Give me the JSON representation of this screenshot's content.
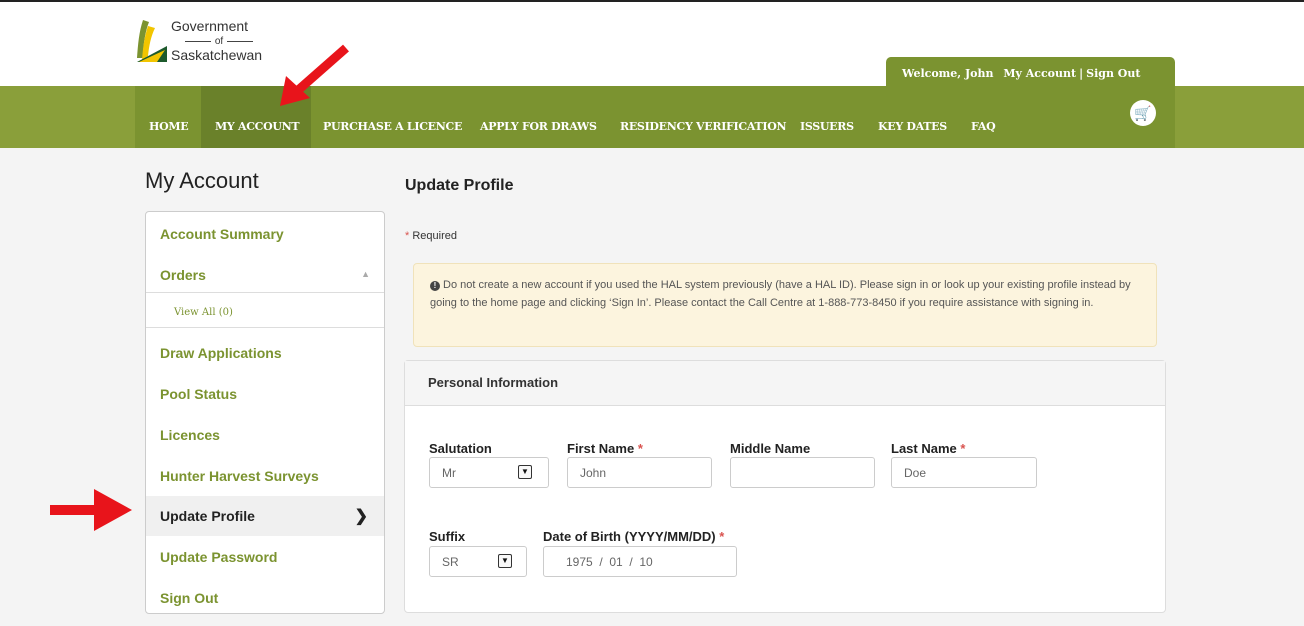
{
  "logo": {
    "line1": "Government",
    "line2": "of",
    "line3": "Saskatchewan"
  },
  "welcome": {
    "greeting": "Welcome, John",
    "account": "My Account",
    "sep": "|",
    "signout": "Sign Out"
  },
  "nav": {
    "items": [
      "HOME",
      "MY ACCOUNT",
      "PURCHASE A LICENCE",
      "APPLY FOR DRAWS",
      "RESIDENCY VERIFICATION",
      "ISSUERS",
      "KEY DATES",
      "FAQ"
    ],
    "cart_icon": "cart-icon"
  },
  "sidebar": {
    "title": "My Account",
    "items": [
      "Account Summary",
      "Orders",
      "View All (0)",
      "Draw Applications",
      "Pool Status",
      "Licences",
      "Hunter Harvest Surveys",
      "Update Profile",
      "Update Password",
      "Sign Out"
    ]
  },
  "main": {
    "title": "Update Profile",
    "required_note": "Required",
    "alert": "Do not create a new account if you used the HAL system previously (have a HAL ID). Please sign in or look up your existing profile instead by going to the home page and clicking ‘Sign In’. Please contact the Call Centre at 1-888-773-8450 if you require assistance with signing in.",
    "panel_title": "Personal Information",
    "fields": {
      "salutation": {
        "label": "Salutation",
        "value": "Mr"
      },
      "first_name": {
        "label": "First Name",
        "value": "John"
      },
      "middle_name": {
        "label": "Middle Name",
        "value": ""
      },
      "last_name": {
        "label": "Last Name",
        "value": "Doe"
      },
      "suffix": {
        "label": "Suffix",
        "value": "SR"
      },
      "dob": {
        "label": "Date of Birth (YYYY/MM/DD)",
        "value": "1975  /  01  /  10"
      }
    }
  },
  "colors": {
    "brand_green": "#7b9330",
    "nav_bg": "#8a9f3a",
    "required": "#d9534f",
    "annotation": "#e8141b"
  }
}
